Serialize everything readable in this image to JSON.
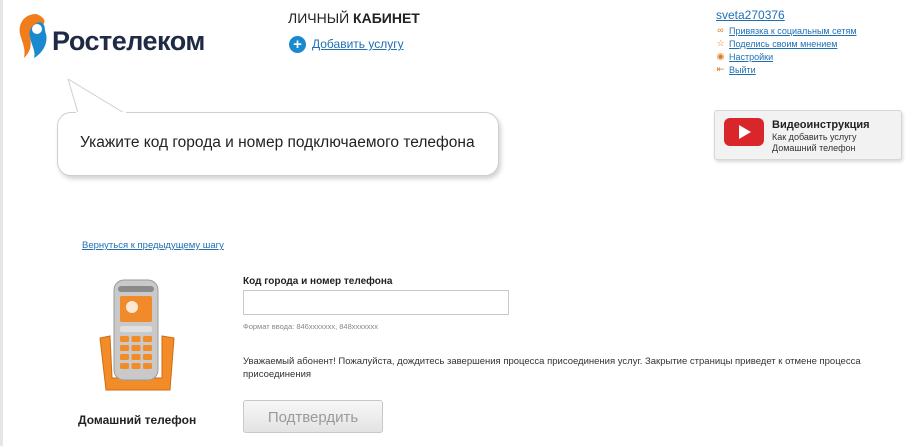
{
  "brand": {
    "name": "Ростелеком"
  },
  "header": {
    "cabinet_light": "ЛИЧНЫЙ",
    "cabinet_bold": "КАБИНЕТ",
    "add_service": "Добавить услугу"
  },
  "user_menu": {
    "username": "sveta270376",
    "items": [
      {
        "label": "Привязка к социальным сетям",
        "icon": "link-icon"
      },
      {
        "label": "Поделись своим мнением",
        "icon": "star-icon"
      },
      {
        "label": "Настройки",
        "icon": "gear-icon"
      },
      {
        "label": "Выйти",
        "icon": "exit-icon"
      }
    ]
  },
  "bubble": {
    "text": "Укажите код города и номер подключаемого телефона"
  },
  "video": {
    "title": "Видеоинструкция",
    "line1": "Как добавить услугу",
    "line2": "Домашний телефон"
  },
  "nav": {
    "back": "Вернуться к предыдущему шагу"
  },
  "product": {
    "caption": "Домашний телефон"
  },
  "form": {
    "label": "Код города и номер телефона",
    "value": "",
    "placeholder": "",
    "hint": "Формат ввода: 846xxxxxxx, 848xxxxxxx",
    "notice": "Уважаемый абонент! Пожалуйста, дождитесь завершения процесса присоединения услуг. Закрытие страницы приведет к отмене процесса присоединения",
    "submit": "Подтвердить"
  },
  "colors": {
    "brand_blue": "#1a8ad0",
    "brand_orange": "#f07d1a",
    "link": "#1f6fb5",
    "youtube_red": "#d8262a"
  }
}
